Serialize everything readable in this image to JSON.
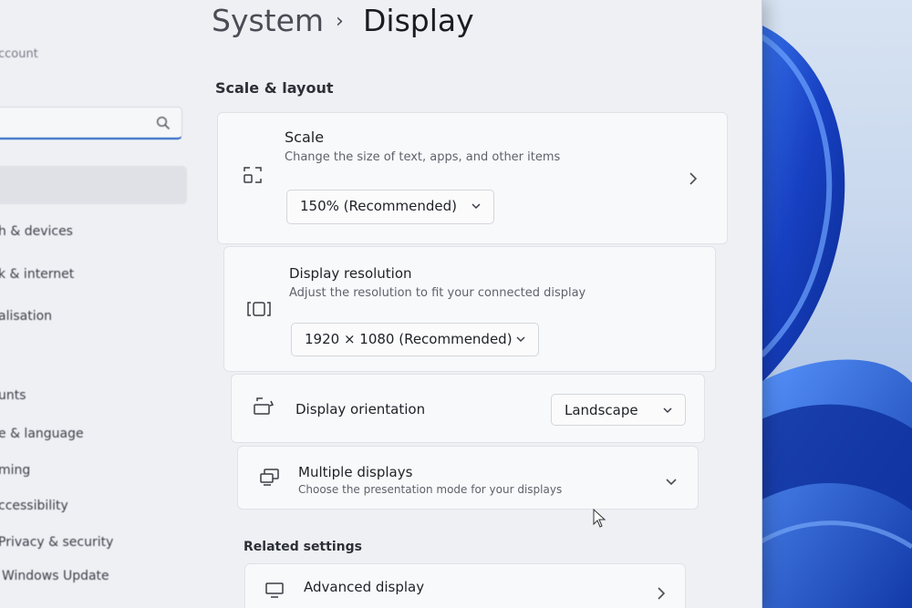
{
  "header": {
    "parent": "System",
    "current": "Display"
  },
  "sidebar": {
    "account": "ccount",
    "search": {
      "placeholder": ""
    },
    "items": [
      {
        "label": "h & devices"
      },
      {
        "label": "k & internet"
      },
      {
        "label": "alisation"
      },
      {
        "label": "unts"
      },
      {
        "label": "e & language"
      },
      {
        "label": "ming"
      },
      {
        "label": "ccessibility"
      },
      {
        "label": "Privacy & security"
      },
      {
        "label": "Windows Update"
      }
    ]
  },
  "sections": {
    "scale_layout": "Scale & layout",
    "related": "Related settings"
  },
  "scale": {
    "title": "Scale",
    "subtitle": "Change the size of text, apps, and other items",
    "value": "150% (Recommended)"
  },
  "resolution": {
    "title": "Display resolution",
    "subtitle": "Adjust the resolution to fit your connected display",
    "value": "1920 × 1080 (Recommended)"
  },
  "orientation": {
    "title": "Display orientation",
    "value": "Landscape"
  },
  "multiple": {
    "title": "Multiple displays",
    "subtitle": "Choose the presentation mode for your displays"
  },
  "advanced": {
    "title": "Advanced display"
  },
  "icons": {
    "search": "search-icon",
    "scale": "scale-icon",
    "resolution": "resolution-icon",
    "orientation": "orientation-icon",
    "multiple": "multiple-displays-icon",
    "advanced": "monitor-icon"
  },
  "colors": {
    "accent": "#1f5fbf",
    "wallpaper": "#1745c9"
  }
}
